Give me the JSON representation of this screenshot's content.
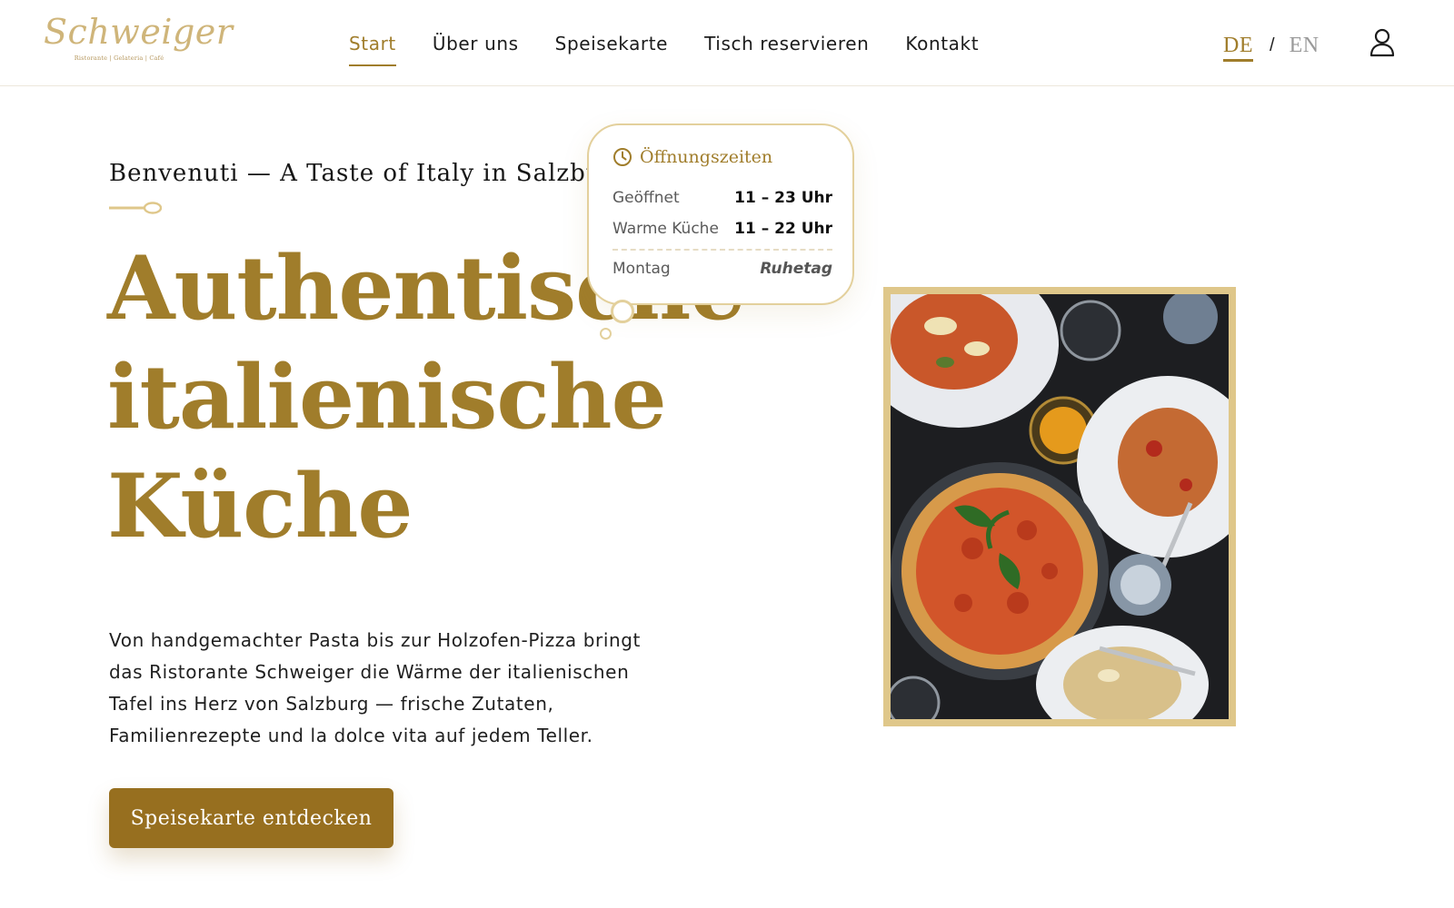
{
  "brand": {
    "logo_script": "Schweiger",
    "logo_tagline": "Ristorante | Gelateria | Café",
    "accent_color": "#a07d2b",
    "button_color": "#976f1f",
    "frame_color": "#dfc78a"
  },
  "nav": {
    "items": [
      {
        "label": "Start",
        "active": true
      },
      {
        "label": "Über uns",
        "active": false
      },
      {
        "label": "Speisekarte",
        "active": false
      },
      {
        "label": "Tisch reservieren",
        "active": false
      },
      {
        "label": "Kontakt",
        "active": false
      }
    ]
  },
  "language": {
    "current": "DE",
    "separator": "/",
    "other": "EN"
  },
  "account": {
    "icon": "user-icon"
  },
  "hero": {
    "eyebrow": "Benvenuti — A Taste of Italy in Salzburg",
    "headline": [
      "Authentische",
      "italienische",
      "Küche"
    ],
    "intro": "Von handgemachter Pasta bis zur Holzofen-Pizza bringt das Ristorante Schweiger die Wärme der italienischen Tafel ins Herz von Salzburg — frische Zutaten, Familienrezepte und la dolce vita auf jedem Teller.",
    "cta_label": "Speisekarte entdecken"
  },
  "hours": {
    "title": "Öffnungszeiten",
    "rows": [
      {
        "label": "Geöffnet",
        "value": "11 – 23 Uhr"
      },
      {
        "label": "Warme Küche",
        "value": "11 – 22 Uhr"
      }
    ],
    "closed": {
      "label": "Montag",
      "value": "Ruhetag"
    }
  }
}
